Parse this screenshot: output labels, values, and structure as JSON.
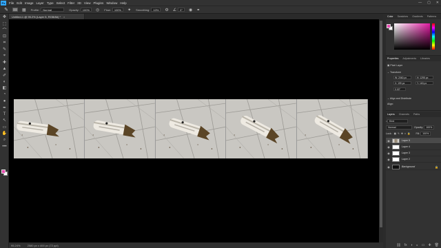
{
  "app": {
    "logo": "Ps"
  },
  "menu": [
    "File",
    "Edit",
    "Image",
    "Layer",
    "Type",
    "Select",
    "Filter",
    "3D",
    "View",
    "Plugins",
    "Window",
    "Help"
  ],
  "window_controls": [
    "—",
    "▢",
    "✕"
  ],
  "options_bar": {
    "profile_label": "Profile:",
    "profile_value": "Normal",
    "opacity_label": "Opacity:",
    "opacity_value": "100%",
    "flow_label": "Flow:",
    "flow_value": "100%",
    "smoothing_label": "Smoothing:",
    "smoothing_value": "10%",
    "angle_value": "0°"
  },
  "toolbar": {
    "tools": [
      "✥",
      "⬚",
      "⌒",
      "⊡",
      "⌗",
      "✎",
      "⌖",
      "✚",
      "▲",
      "✐",
      "◐",
      "◧",
      "◔",
      "●",
      "✒",
      "T",
      "↖",
      "▭",
      "✋",
      "⌕",
      "•••"
    ]
  },
  "document": {
    "tab_title": "Untitled-1 @ 95.2% (Layer 5, RGB/8#) *",
    "close": "×",
    "frames_count": 5
  },
  "status": {
    "zoom": "95.24%",
    "doc_info": "2580 px x 400 px (72 ppi)"
  },
  "color_panel": {
    "tabs": [
      "Color",
      "Swatches",
      "Gradients",
      "Patterns"
    ],
    "fg_color": "#e84ab0",
    "bg_color": "#ffffff"
  },
  "properties_panel": {
    "tabs": [
      "Properties",
      "Adjustments",
      "Libraries"
    ],
    "kind": "Pixel Layer",
    "section_transform": "Transform",
    "w_value": "W: 2060 px",
    "h_value": "H: 1295 px",
    "x_value": "X: 199 px",
    "y_value": "Y: 163 px",
    "angle_value": "0.00°",
    "section_align": "Align and Distribute",
    "align_label": "Align:"
  },
  "layers_panel": {
    "tabs": [
      "Layers",
      "Channels",
      "Paths"
    ],
    "search_placeholder": "Kind",
    "blend_mode": "Normal",
    "opacity_label": "Opacity:",
    "opacity_value": "100%",
    "lock_label": "Lock:",
    "fill_label": "Fill:",
    "fill_value": "100%",
    "layers": [
      {
        "name": "Layer 5",
        "selected": true
      },
      {
        "name": "Layer 4",
        "selected": false
      },
      {
        "name": "Layer 3",
        "selected": false
      },
      {
        "name": "Layer 2",
        "selected": false
      },
      {
        "name": "Background",
        "selected": false
      }
    ],
    "footer_icons": [
      "⛓",
      "fx",
      "◑",
      "◒",
      "▭",
      "✚",
      "🗑"
    ]
  }
}
